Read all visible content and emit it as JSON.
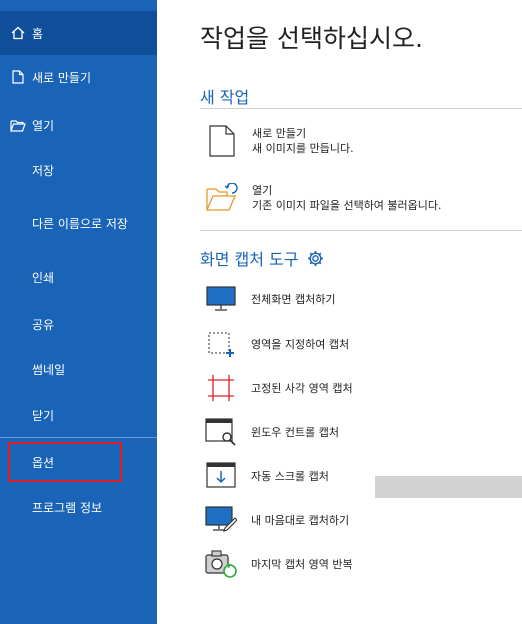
{
  "sidebar": {
    "items": [
      {
        "label": "홈",
        "icon": "home-icon"
      },
      {
        "label": "새로 만들기",
        "icon": "new-file-icon"
      },
      {
        "label": "열기",
        "icon": "folder-open-icon"
      },
      {
        "label": "저장"
      },
      {
        "label": "다른 이름으로 저장"
      },
      {
        "label": "인쇄"
      },
      {
        "label": "공유"
      },
      {
        "label": "썸네일"
      },
      {
        "label": "닫기"
      },
      {
        "label": "옵션"
      },
      {
        "label": "프로그램 정보"
      }
    ]
  },
  "main": {
    "title": "작업을 선택하십시오.",
    "new_section": {
      "title": "새 작업",
      "actions": [
        {
          "title": "새로 만들기",
          "desc": "새 이미지를 만듭니다.",
          "icon": "blank-document-icon"
        },
        {
          "title": "열기",
          "desc": "기존 이미지 파일을 선택하여 불러옵니다.",
          "icon": "open-folder-icon"
        }
      ]
    },
    "capture_section": {
      "title": "화면 캡처 도구",
      "items": [
        {
          "label": "전체화면 캡처하기",
          "icon": "fullscreen-capture-icon"
        },
        {
          "label": "영역을 지정하여 캡처",
          "icon": "region-capture-icon"
        },
        {
          "label": "고정된 사각 영역 캡처",
          "icon": "fixed-rect-capture-icon"
        },
        {
          "label": "윈도우 컨트롤 캡처",
          "icon": "window-control-capture-icon"
        },
        {
          "label": "자동 스크롤 캡처",
          "icon": "auto-scroll-capture-icon"
        },
        {
          "label": "내 마음대로 캡처하기",
          "icon": "freehand-capture-icon"
        },
        {
          "label": "마지막 캡처 영역 반복",
          "icon": "repeat-last-capture-icon"
        }
      ]
    }
  },
  "colors": {
    "sidebar": "#1a64b8",
    "sidebar_active": "#0f4f99",
    "accent": "#1a64b8",
    "highlight": "#e01c24"
  }
}
